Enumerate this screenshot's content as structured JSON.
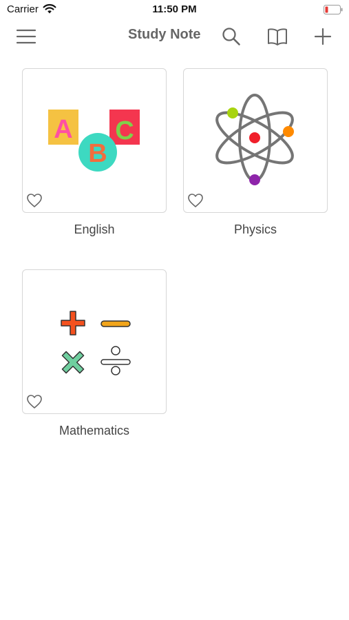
{
  "status_bar": {
    "carrier": "Carrier",
    "time": "11:50 PM",
    "wifi_icon": "wifi-icon",
    "battery_icon": "battery-low-icon",
    "battery_color": "#e53935"
  },
  "nav_bar": {
    "title": "Study Note",
    "menu_icon": "hamburger-menu-icon",
    "search_icon": "search-icon",
    "book_icon": "open-book-icon",
    "add_icon": "plus-icon"
  },
  "notebooks": [
    {
      "label": "English",
      "icon": "abc-blocks-icon",
      "favorite_icon": "heart-outline-icon"
    },
    {
      "label": "Physics",
      "icon": "atom-icon",
      "favorite_icon": "heart-outline-icon"
    },
    {
      "label": "Mathematics",
      "icon": "math-operators-icon",
      "favorite_icon": "heart-outline-icon"
    }
  ],
  "colors": {
    "title_gray": "#666666",
    "card_border": "#d6d6d6",
    "abc_yellow": "#f5c242",
    "abc_pink": "#ff4fa3",
    "abc_teal": "#3dd9c1",
    "abc_orange": "#f26d3d",
    "abc_red": "#f4364f",
    "abc_green": "#7fd14a",
    "atom_nucleus": "#f01f2a",
    "atom_green": "#a8d40f",
    "atom_orange": "#ff8a00",
    "atom_purple": "#8e24aa",
    "math_plus": "#f4511e",
    "math_minus": "#f2a51a",
    "math_times": "#6fcf9f"
  }
}
